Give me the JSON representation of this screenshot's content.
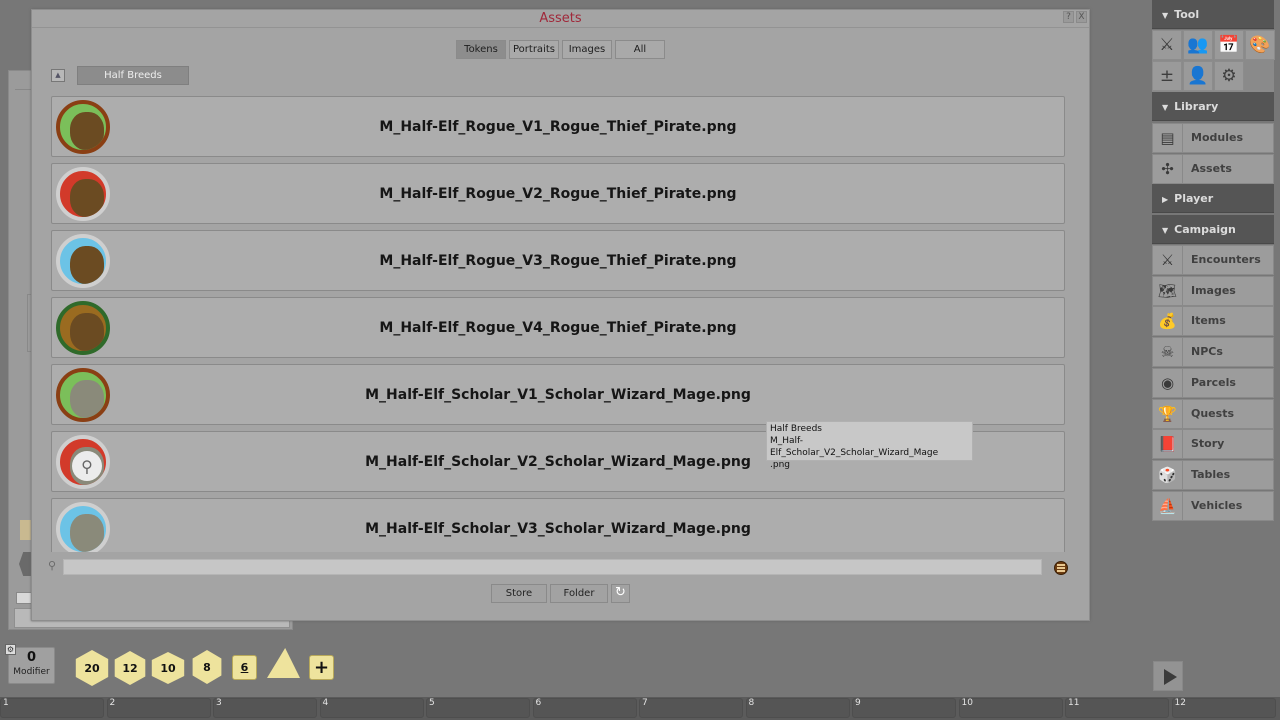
{
  "window": {
    "title": "Assets",
    "help_label": "?",
    "close_label": "X",
    "filters": [
      {
        "label": "Tokens",
        "active": true
      },
      {
        "label": "Portraits",
        "active": false
      },
      {
        "label": "Images",
        "active": false
      },
      {
        "label": "All",
        "active": false
      }
    ],
    "up_label": "▲",
    "current_folder": "Half Breeds",
    "items": [
      {
        "name": "M_Half-Elf_Rogue_V1_Rogue_Thief_Pirate.png",
        "frame": "#8a3f14",
        "bg": "#7bbf5a",
        "face": "#6b4b22"
      },
      {
        "name": "M_Half-Elf_Rogue_V2_Rogue_Thief_Pirate.png",
        "frame": "#cfcfcf",
        "bg": "#d23a2a",
        "face": "#6b4b22"
      },
      {
        "name": "M_Half-Elf_Rogue_V3_Rogue_Thief_Pirate.png",
        "frame": "#cfcfcf",
        "bg": "#6cc3e6",
        "face": "#6b4b22"
      },
      {
        "name": "M_Half-Elf_Rogue_V4_Rogue_Thief_Pirate.png",
        "frame": "#2f6a2a",
        "bg": "#9a6b20",
        "face": "#6b4b22"
      },
      {
        "name": "M_Half-Elf_Scholar_V1_Scholar_Wizard_Mage.png",
        "frame": "#8a3f14",
        "bg": "#7bbf5a",
        "face": "#8a8a7a"
      },
      {
        "name": "M_Half-Elf_Scholar_V2_Scholar_Wizard_Mage.png",
        "frame": "#cfcfcf",
        "bg": "#d23a2a",
        "face": "#8a8a7a"
      },
      {
        "name": "M_Half-Elf_Scholar_V3_Scholar_Wizard_Mage.png",
        "frame": "#cfcfcf",
        "bg": "#6cc3e6",
        "face": "#8a8a7a"
      }
    ],
    "tooltip": {
      "line1": "Half Breeds",
      "line2": "M_Half-Elf_Scholar_V2_Scholar_Wizard_Mage",
      "line3": ".png"
    },
    "search": {
      "value": "",
      "placeholder": ""
    },
    "store_label": "Store",
    "folder_label": "Folder",
    "refresh_icon": "↻"
  },
  "sidebar": {
    "tool_header": "Tool",
    "tools": [
      {
        "icon": "crossed-swords-icon",
        "glyph": "⚔"
      },
      {
        "icon": "party-icon",
        "glyph": "👥"
      },
      {
        "icon": "calendar-icon",
        "glyph": "📅"
      },
      {
        "icon": "palette-icon",
        "glyph": "🎨"
      },
      {
        "icon": "modifier-icon",
        "glyph": "±"
      },
      {
        "icon": "character-icon",
        "glyph": "👤"
      },
      {
        "icon": "gear-icon",
        "glyph": "⚙"
      }
    ],
    "library_header": "Library",
    "library": [
      {
        "label": "Modules",
        "icon": "modules-icon",
        "glyph": "▤"
      },
      {
        "label": "Assets",
        "icon": "puzzle-icon",
        "glyph": "✣"
      }
    ],
    "player_header": "Player",
    "campaign_header": "Campaign",
    "campaign": [
      {
        "label": "Encounters",
        "icon": "crossed-swords-icon",
        "glyph": "⚔"
      },
      {
        "label": "Images",
        "icon": "map-icon",
        "glyph": "🗺"
      },
      {
        "label": "Items",
        "icon": "bag-icon",
        "glyph": "💰"
      },
      {
        "label": "NPCs",
        "icon": "skull-icon",
        "glyph": "☠"
      },
      {
        "label": "Parcels",
        "icon": "coins-icon",
        "glyph": "◉"
      },
      {
        "label": "Quests",
        "icon": "chalice-icon",
        "glyph": "🏆"
      },
      {
        "label": "Story",
        "icon": "book-icon",
        "glyph": "📕"
      },
      {
        "label": "Tables",
        "icon": "dice-icon",
        "glyph": "🎲"
      },
      {
        "label": "Vehicles",
        "icon": "ship-icon",
        "glyph": "⛵"
      }
    ]
  },
  "dice_tray": {
    "modifier_value": "0",
    "modifier_label": "Modifier",
    "dice": [
      {
        "label": "20",
        "name": "d20-die"
      },
      {
        "label": "12",
        "name": "d12-die"
      },
      {
        "label": "10",
        "name": "d10-die"
      },
      {
        "label": "8",
        "name": "d8-die"
      },
      {
        "label": "6",
        "name": "d6-die"
      },
      {
        "label": "",
        "name": "d4-die"
      },
      {
        "label": "+",
        "name": "add-die"
      }
    ]
  },
  "hotkeys": [
    "1",
    "2",
    "3",
    "4",
    "5",
    "6",
    "7",
    "8",
    "9",
    "10",
    "11",
    "12"
  ]
}
